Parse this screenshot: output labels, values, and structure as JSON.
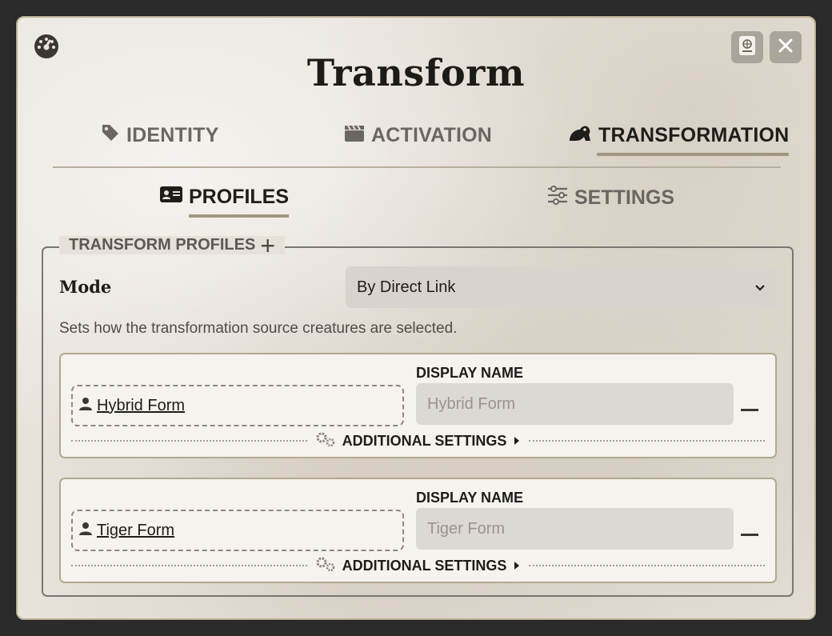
{
  "window": {
    "title": "Transform",
    "sheet_icon": "sheet-icon",
    "close_icon": "close-icon"
  },
  "tabs": [
    {
      "label": "IDENTITY",
      "icon": "tag-icon",
      "active": false
    },
    {
      "label": "ACTIVATION",
      "icon": "clapperboard-icon",
      "active": false
    },
    {
      "label": "TRANSFORMATION",
      "icon": "frog-icon",
      "active": true
    }
  ],
  "subtabs": [
    {
      "label": "PROFILES",
      "icon": "id-card-icon",
      "active": true
    },
    {
      "label": "SETTINGS",
      "icon": "sliders-icon",
      "active": false
    }
  ],
  "profiles_section": {
    "legend": "TRANSFORM PROFILES",
    "add_glyph": "+",
    "mode_label": "Mode",
    "mode_value": "By Direct Link",
    "mode_hint": "Sets how the transformation source creatures are selected.",
    "display_name_label": "DISPLAY NAME",
    "additional_settings_label": "ADDITIONAL SETTINGS",
    "profiles": [
      {
        "link_name": "Hybrid Form",
        "display_name_placeholder": "Hybrid Form",
        "display_name_value": ""
      },
      {
        "link_name": "Tiger Form",
        "display_name_placeholder": "Tiger Form",
        "display_name_value": ""
      }
    ]
  },
  "colors": {
    "accent_underline": "#9f967f",
    "panel_bg": "#e8e3db",
    "card_bg": "#f6f3ef"
  }
}
